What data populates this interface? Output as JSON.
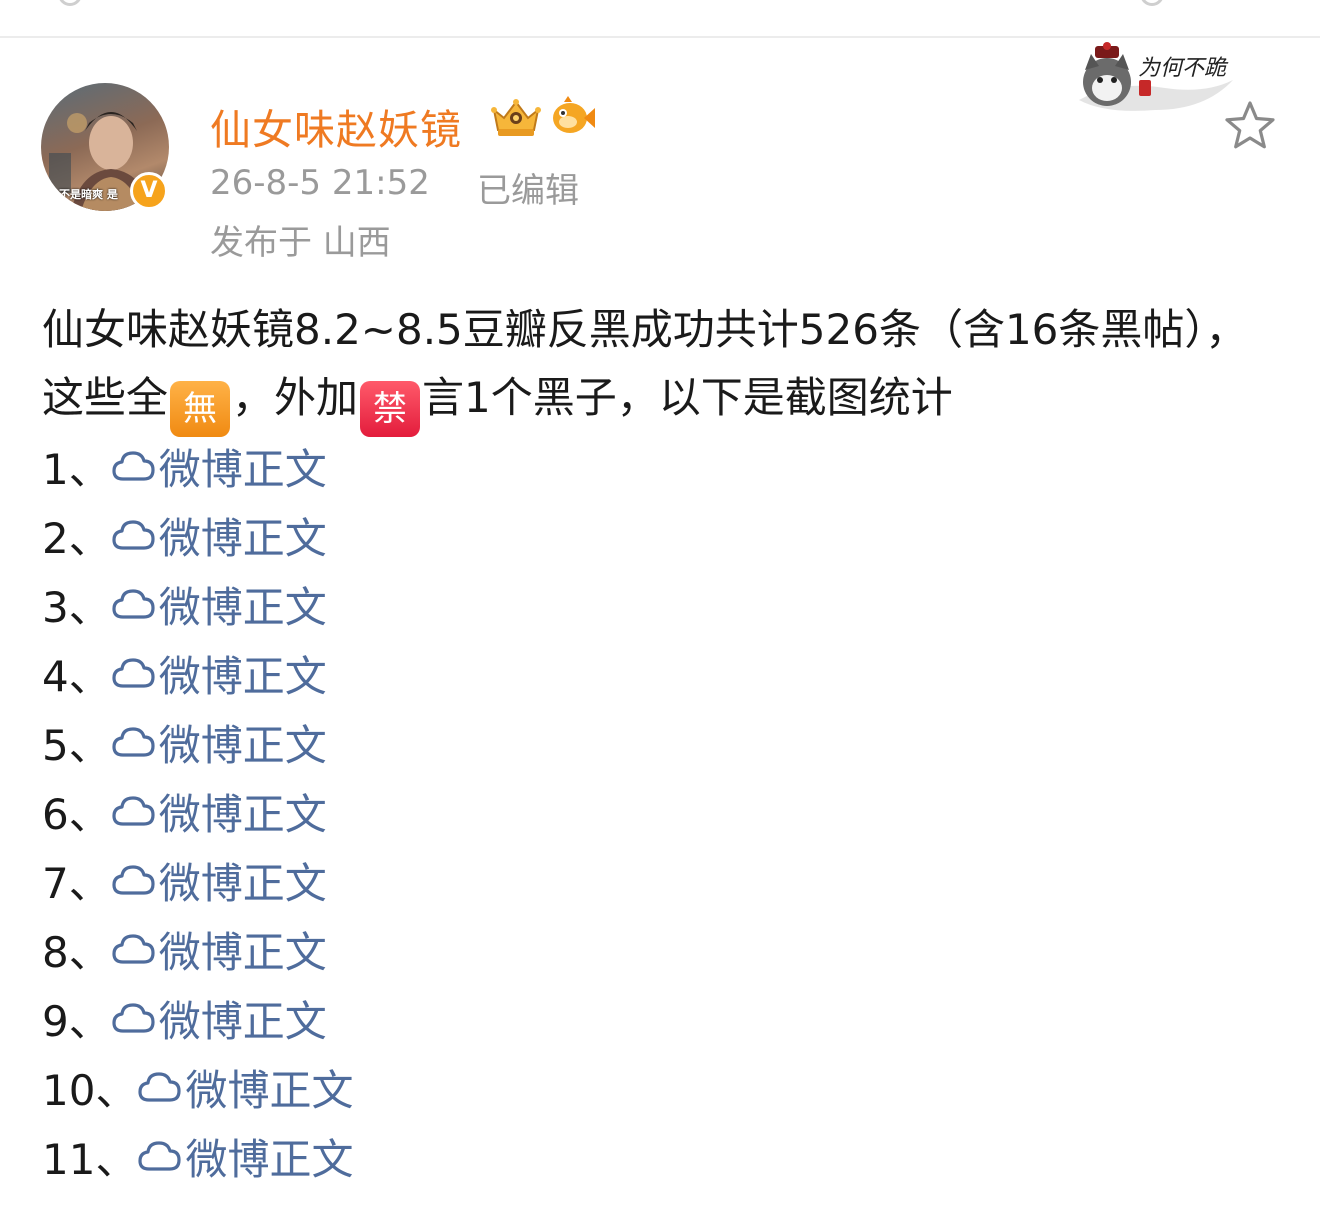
{
  "post": {
    "author": {
      "name": "仙女味赵妖镜",
      "avatar_caption": "不是暗爽 是",
      "verified_mark": "V",
      "badges": [
        "crown-badge-icon",
        "fish-badge-icon"
      ]
    },
    "timestamp": "26-8-5 21:52",
    "edited_label": "已编辑",
    "location": "发布于 山西",
    "pendant_text": "为何不跪",
    "favorite_icon": "star-icon"
  },
  "content": {
    "text_part1": "仙女味赵妖镜8.2~8.5豆瓣反黑成功共计526条（含16条黑帖），这些全",
    "emoji1": "無",
    "text_part2": "，外加",
    "emoji2": "禁",
    "text_part3": "言1个黑子，以下是截图统计"
  },
  "links": [
    {
      "index": "1、",
      "label": "微博正文"
    },
    {
      "index": "2、",
      "label": "微博正文"
    },
    {
      "index": "3、",
      "label": "微博正文"
    },
    {
      "index": "4、",
      "label": "微博正文"
    },
    {
      "index": "5、",
      "label": "微博正文"
    },
    {
      "index": "6、",
      "label": "微博正文"
    },
    {
      "index": "7、",
      "label": "微博正文"
    },
    {
      "index": "8、",
      "label": "微博正文"
    },
    {
      "index": "9、",
      "label": "微博正文"
    },
    {
      "index": "10、",
      "label": "微博正文"
    },
    {
      "index": "11、",
      "label": "微博正文"
    }
  ],
  "colors": {
    "username": "#ef7a22",
    "link": "#4f6c9c",
    "meta": "#9a9a9a",
    "verified": "#f6a31c"
  }
}
